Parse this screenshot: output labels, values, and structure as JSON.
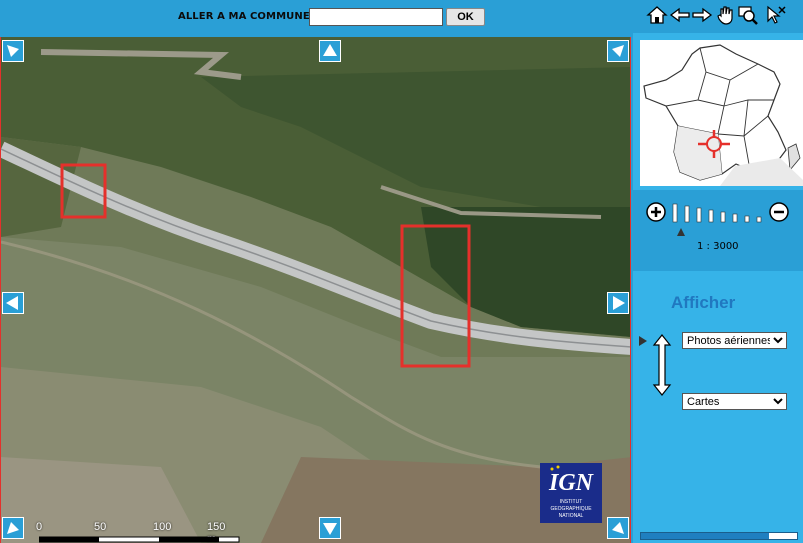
{
  "search": {
    "label": "ALLER A MA COMMUNE",
    "value": "",
    "button": "OK"
  },
  "map": {
    "scale_labels": [
      "0",
      "50",
      "100",
      "150 m"
    ],
    "logo": {
      "text": "IGN",
      "subtitle": "INSTITUT GEOGRAPHIQUE NATIONAL"
    },
    "pan_icons": [
      "pan-up-left-icon",
      "pan-up-icon",
      "pan-up-right-icon",
      "pan-left-icon",
      "pan-right-icon",
      "pan-down-left-icon",
      "pan-down-icon",
      "pan-down-right-icon"
    ]
  },
  "tools": [
    "home-icon",
    "back-arrow-icon",
    "forward-arrow-icon",
    "hand-pan-icon",
    "zoom-magnifier-icon",
    "select-cursor-icon"
  ],
  "zoom": {
    "scale_text": "1 : 3000",
    "levels": 8,
    "current_level": 1
  },
  "display": {
    "heading": "Afficher",
    "layer_top": "Photos aériennes",
    "layer_bottom": "Cartes"
  },
  "progress": 0.82,
  "colors": {
    "panel": "#36b3e8",
    "header": "#2a9fd6",
    "highlight": "#e5302b",
    "heading": "#2078c0"
  }
}
